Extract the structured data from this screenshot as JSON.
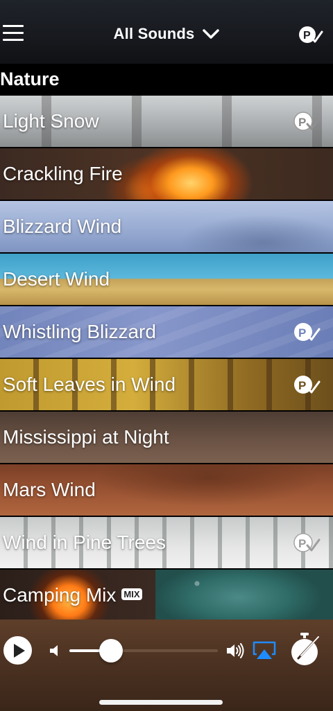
{
  "header": {
    "menu_icon": "hamburger-menu-icon",
    "title": "All Sounds",
    "dropdown_icon": "chevron-down-icon",
    "premium_icon": "premium-check-icon"
  },
  "section": {
    "label": "Nature"
  },
  "sounds": [
    {
      "name": "Light Snow",
      "premium": true
    },
    {
      "name": "Crackling Fire",
      "premium": false
    },
    {
      "name": "Blizzard Wind",
      "premium": false
    },
    {
      "name": "Desert Wind",
      "premium": false
    },
    {
      "name": "Whistling Blizzard",
      "premium": true
    },
    {
      "name": "Soft Leaves in Wind",
      "premium": true
    },
    {
      "name": "Mississippi at Night",
      "premium": false
    },
    {
      "name": "Mars Wind",
      "premium": false
    },
    {
      "name": "Wind in Pine Trees",
      "premium": true
    },
    {
      "name": "Camping Mix",
      "premium": false,
      "tag": "MIX"
    }
  ],
  "player": {
    "play_icon": "play-icon",
    "volume_low_icon": "volume-low-icon",
    "volume_high_icon": "volume-high-icon",
    "airplay_icon": "airplay-icon",
    "timer_icon": "timer-icon",
    "volume_level": 0.28
  },
  "colors": {
    "airplay_accent": "#1e8cff",
    "premium_light": "#ffffff",
    "premium_dim": "#d9d9d9"
  }
}
